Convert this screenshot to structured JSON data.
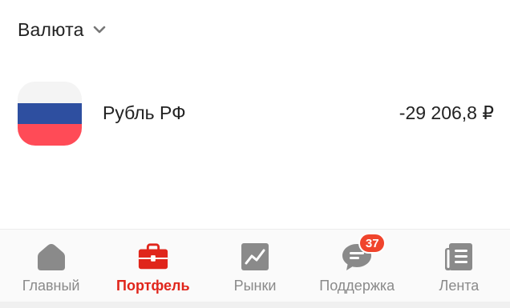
{
  "section": {
    "title": "Валюта",
    "chevron_icon": "chevron-down-icon"
  },
  "assets": [
    {
      "name": "Рубль РФ",
      "value": "-29 206,8 ₽",
      "flag": {
        "icon": "russia-flag-icon",
        "colors": [
          "#f4f4f4",
          "#2e4fa0",
          "#ff4b57"
        ]
      }
    }
  ],
  "tabbar": {
    "tabs": [
      {
        "label": "Главный",
        "icon": "home-icon",
        "active": false
      },
      {
        "label": "Портфель",
        "icon": "briefcase-icon",
        "active": true
      },
      {
        "label": "Рынки",
        "icon": "chart-icon",
        "active": false
      },
      {
        "label": "Поддержка",
        "icon": "chat-icon",
        "active": false,
        "badge": "37"
      },
      {
        "label": "Лента",
        "icon": "feed-icon",
        "active": false
      }
    ]
  },
  "colors": {
    "accent": "#e0251b",
    "badge": "#f0442c",
    "icon_inactive": "#8a8a8a",
    "text": "#222222"
  }
}
